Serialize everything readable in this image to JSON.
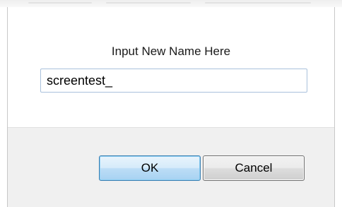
{
  "dialog": {
    "prompt": "Input New Name Here",
    "name_value": "screentest_",
    "ok_label": "OK",
    "cancel_label": "Cancel"
  },
  "colors": {
    "ok_border": "#3c7fb1",
    "input_border": "#a9c1dc",
    "button_bar": "#f0f0f0"
  }
}
